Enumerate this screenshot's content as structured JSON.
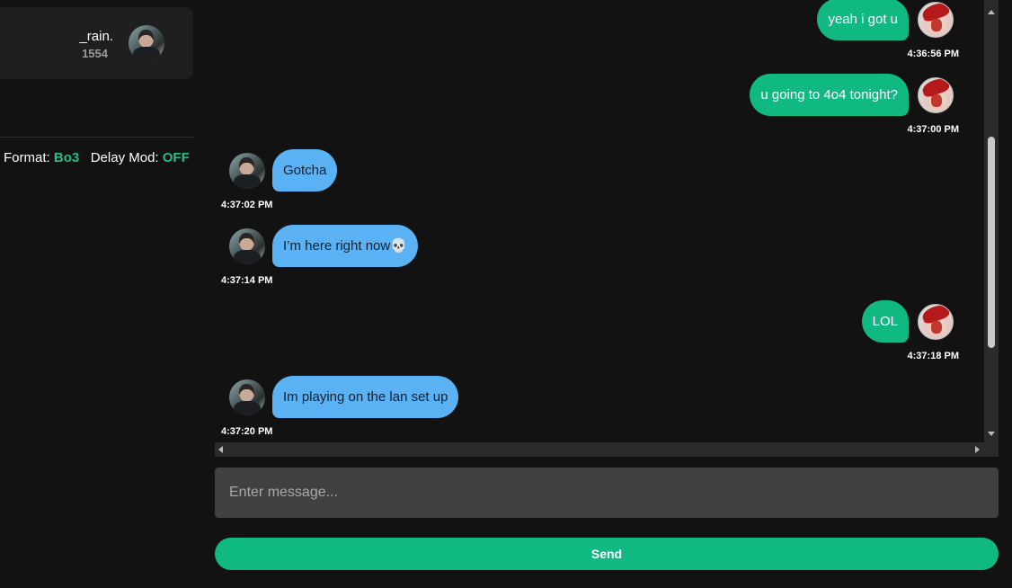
{
  "player": {
    "name": "_rain.",
    "rating": "1554"
  },
  "match": {
    "format_label": "Format:",
    "format_value": "Bo3",
    "delay_label": "Delay Mod:",
    "delay_value": "OFF"
  },
  "messages": [
    {
      "direction": "out",
      "text": "yeah i got u",
      "time": "4:36:56 PM"
    },
    {
      "direction": "out",
      "text": "u going to 4o4 tonight?",
      "time": "4:37:00 PM"
    },
    {
      "direction": "in",
      "text": "Gotcha",
      "time": "4:37:02 PM"
    },
    {
      "direction": "in",
      "text": "I’m here right now💀",
      "time": "4:37:14 PM"
    },
    {
      "direction": "out",
      "text": "LOL",
      "time": "4:37:18 PM"
    },
    {
      "direction": "in",
      "text": "Im playing on the lan set up",
      "time": "4:37:20 PM"
    }
  ],
  "composer": {
    "placeholder": "Enter message...",
    "send_label": "Send"
  },
  "colors": {
    "accent": "#10b981",
    "incoming_bubble": "#5ab1f4",
    "background": "#121212"
  }
}
